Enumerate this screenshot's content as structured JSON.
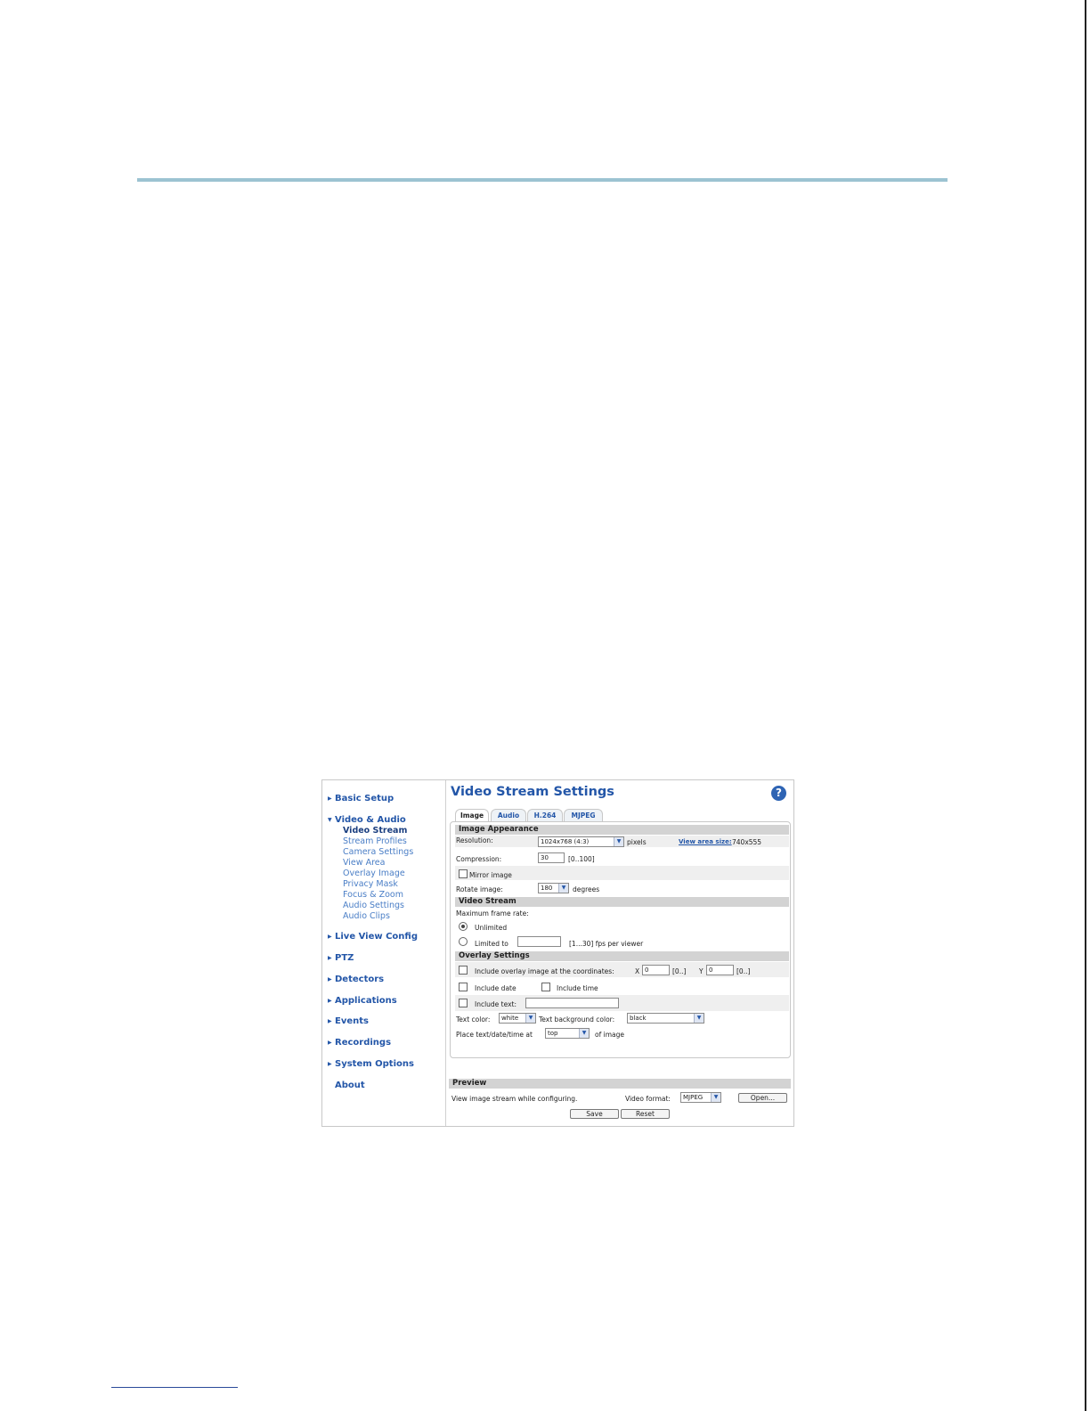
{
  "nav": {
    "items": [
      {
        "label": "Basic Setup",
        "expanded": false
      },
      {
        "label": "Video & Audio",
        "expanded": true,
        "subitems": [
          "Video Stream",
          "Stream Profiles",
          "Camera Settings",
          "View Area",
          "Overlay Image",
          "Privacy Mask",
          "Focus & Zoom",
          "Audio Settings",
          "Audio Clips"
        ],
        "active_subitem": "Video Stream"
      },
      {
        "label": "Live View Config"
      },
      {
        "label": "PTZ"
      },
      {
        "label": "Detectors"
      },
      {
        "label": "Applications"
      },
      {
        "label": "Events"
      },
      {
        "label": "Recordings"
      },
      {
        "label": "System Options"
      },
      {
        "label": "About"
      }
    ]
  },
  "page": {
    "title": "Video Stream Settings",
    "help_icon": "?",
    "tabs": [
      "Image",
      "Audio",
      "H.264",
      "MJPEG"
    ],
    "active_tab": "Image"
  },
  "image_appearance": {
    "header": "Image Appearance",
    "resolution_label": "Resolution:",
    "resolution_value": "1024x768 (4:3)",
    "resolution_unit": "pixels",
    "view_area_link": "View area size:",
    "view_area_value": "740x555",
    "compression_label": "Compression:",
    "compression_value": "30",
    "compression_range": "[0..100]",
    "mirror_label": "Mirror image",
    "mirror_checked": false,
    "rotate_label": "Rotate image:",
    "rotate_value": "180",
    "rotate_unit": "degrees"
  },
  "video_stream": {
    "header": "Video Stream",
    "max_frame_label": "Maximum frame rate:",
    "unlimited_label": "Unlimited",
    "limited_label": "Limited to",
    "limited_value": "",
    "fps_range": "[1...30] fps per viewer",
    "selected": "Unlimited"
  },
  "overlay": {
    "header": "Overlay Settings",
    "include_image_label": "Include overlay image at the coordinates:",
    "x_label": "X",
    "x_value": "0",
    "x_range": "[0..]",
    "y_label": "Y",
    "y_value": "0",
    "y_range": "[0..]",
    "include_date_label": "Include date",
    "include_time_label": "Include time",
    "include_text_label": "Include text:",
    "include_text_value": "",
    "text_color_label": "Text color:",
    "text_color_value": "white",
    "text_bg_label": "Text background color:",
    "text_bg_value": "black",
    "place_label": "Place text/date/time at",
    "place_value": "top",
    "place_suffix": "of image"
  },
  "preview": {
    "header": "Preview",
    "description": "View image stream while configuring.",
    "format_label": "Video format:",
    "format_value": "MJPEG",
    "open_button": "Open..."
  },
  "buttons": {
    "save": "Save",
    "reset": "Reset"
  },
  "colors": {
    "accent": "#2356a8",
    "rule": "#9cc3d2",
    "section_bg": "#d3d3d3"
  }
}
